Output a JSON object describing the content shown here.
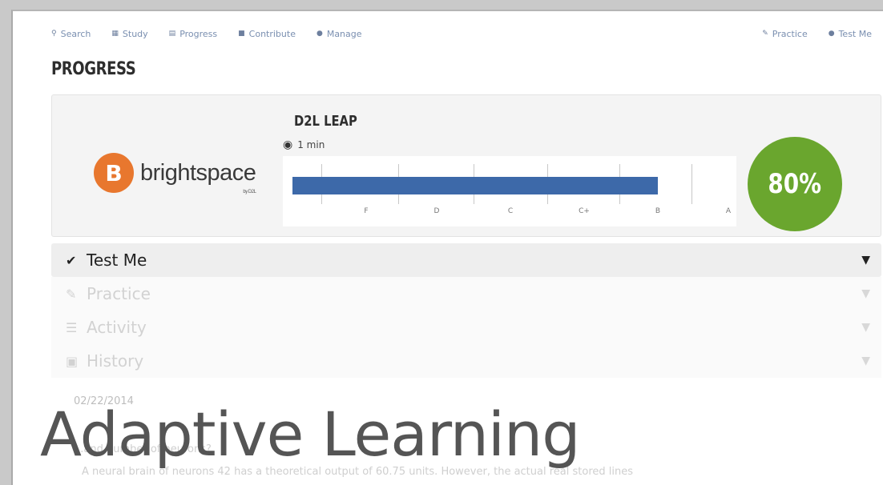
{
  "nav": {
    "left": [
      {
        "icon": "search-icon",
        "glyph": "⚲",
        "label": "Search"
      },
      {
        "icon": "study-icon",
        "glyph": "▦",
        "label": "Study"
      },
      {
        "icon": "progress-icon",
        "glyph": "▤",
        "label": "Progress"
      },
      {
        "icon": "contribute-icon",
        "glyph": "■",
        "label": "Contribute"
      },
      {
        "icon": "manage-icon",
        "glyph": "●",
        "label": "Manage"
      }
    ],
    "right": [
      {
        "icon": "pencil-icon",
        "glyph": "✎",
        "label": "Practice"
      },
      {
        "icon": "check-circle-icon",
        "glyph": "●",
        "label": "Test Me"
      }
    ]
  },
  "page_title": "PROGRESS",
  "course": {
    "title": "D2L LEAP",
    "time": "1 min",
    "logo_text": "brightspace",
    "logo_letter": "B",
    "logo_sub": "by D2L",
    "score": "80%",
    "progress": 0.8,
    "grade_labels": [
      "F",
      "D",
      "C",
      "C+",
      "B",
      "A"
    ],
    "colors": {
      "bar": "#3d69a9",
      "score": "#6aa62e",
      "logo": "#e8772e"
    }
  },
  "sections": [
    {
      "label": "Test Me",
      "icon": "check-circle-icon",
      "glyph": "✔"
    },
    {
      "label": "Practice",
      "icon": "pencil-icon",
      "glyph": "✎"
    },
    {
      "label": "Activity",
      "icon": "list-icon",
      "glyph": "☰"
    },
    {
      "label": "History",
      "icon": "calendar-icon",
      "glyph": "▣"
    }
  ],
  "history": {
    "date": "02/22/2014",
    "question": "...and number of neurons?",
    "answer": "A neural brain of neurons 42 has a theoretical output of 60.75 units. However, the actual real stored lines"
  },
  "overlay_title": "Adaptive Learning"
}
